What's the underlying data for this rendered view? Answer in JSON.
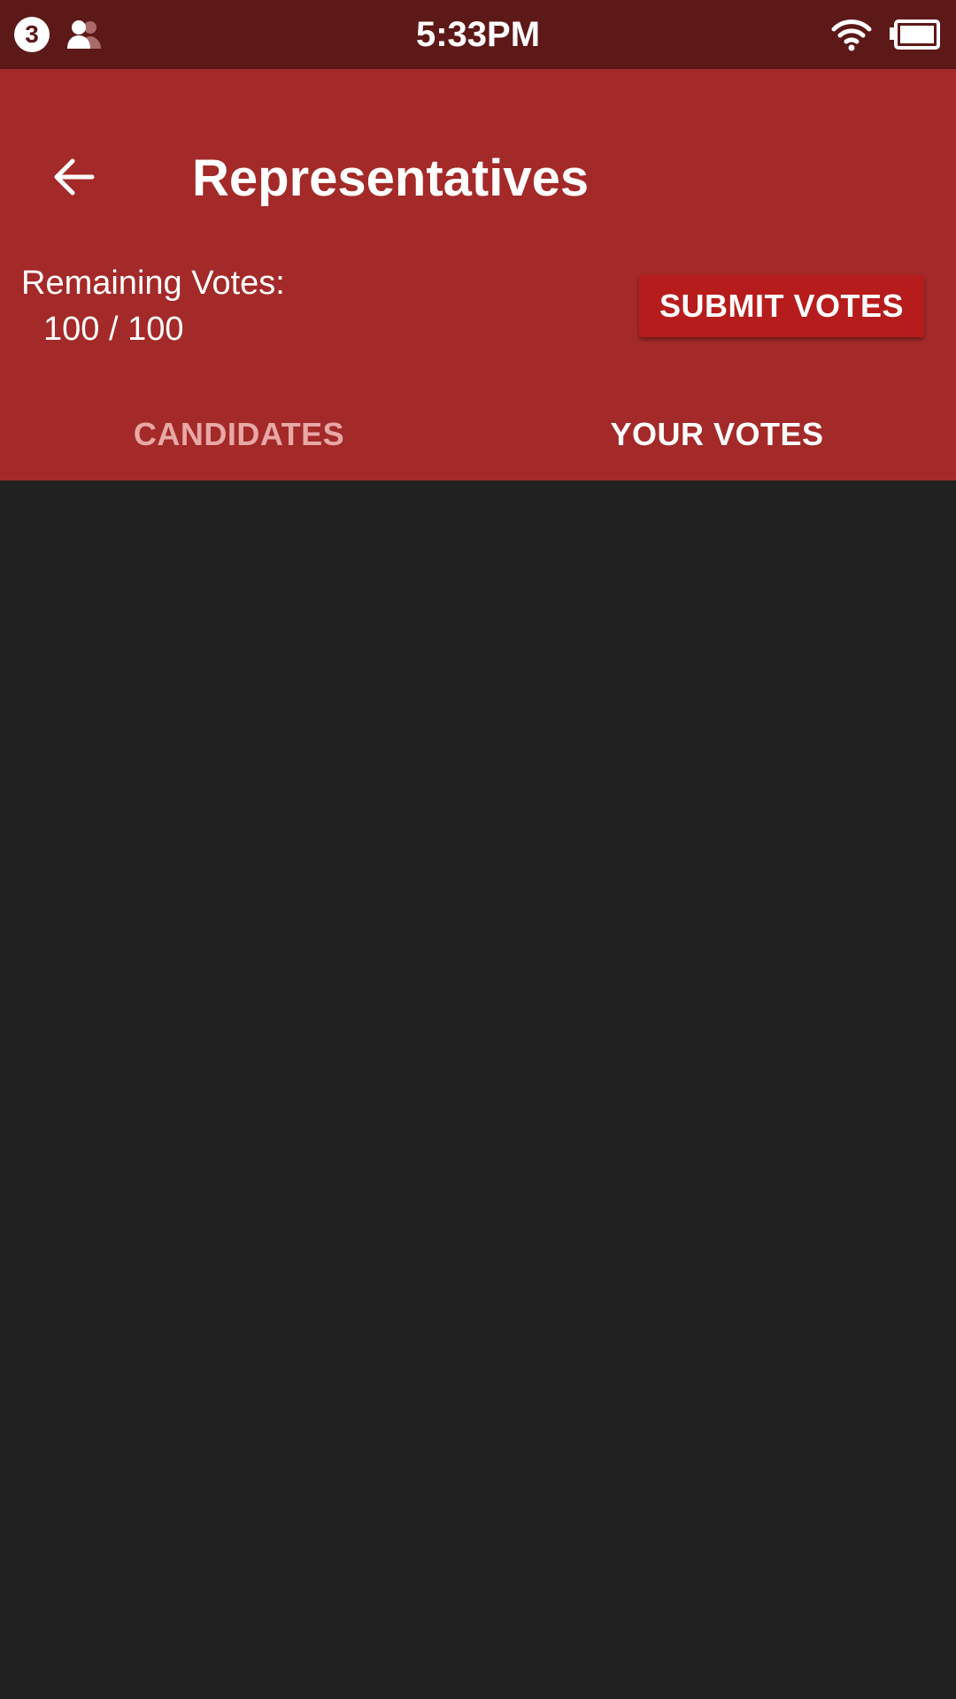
{
  "status_bar": {
    "notification_count": "3",
    "time": "5:33PM",
    "icons": [
      "people-icon",
      "wifi-icon",
      "battery-icon"
    ]
  },
  "header": {
    "title": "Representatives",
    "back_icon": "arrow-left-icon",
    "remaining_votes_label": "Remaining Votes:",
    "remaining_votes_value": "100 / 100",
    "submit_label": "SUBMIT VOTES"
  },
  "tabs": [
    {
      "label": "CANDIDATES",
      "selected": false
    },
    {
      "label": "YOUR VOTES",
      "selected": true
    }
  ],
  "colors": {
    "status_bar": "#5d1818",
    "app_bar": "#a32a29",
    "submit_button": "#b71c1c",
    "background": "#212121",
    "tab_inactive_text": "#e8a8a6"
  }
}
